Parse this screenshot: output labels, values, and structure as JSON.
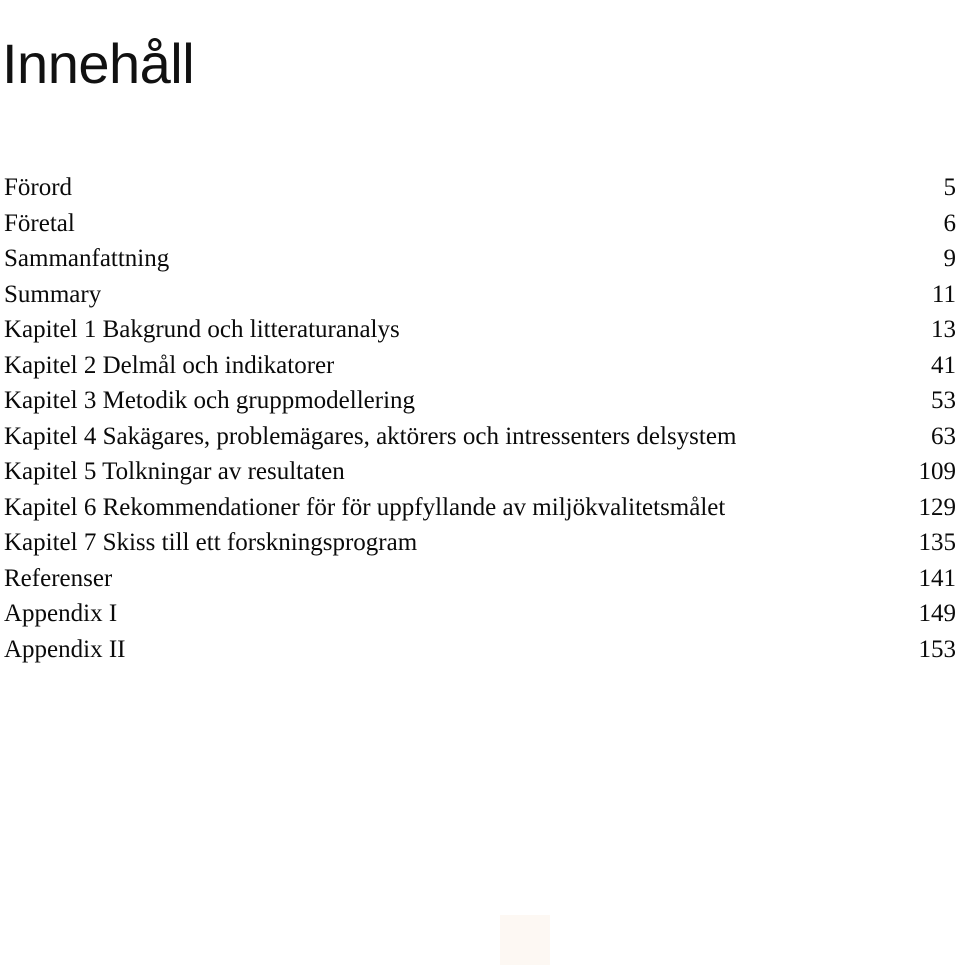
{
  "document": {
    "title": "Innehåll",
    "background_color": "#ffffff",
    "text_color": "#0a0a0a"
  },
  "toc": {
    "entries": [
      {
        "label": "Förord",
        "page": "5"
      },
      {
        "label": "Företal",
        "page": "6"
      },
      {
        "label": "Sammanfattning",
        "page": "9"
      },
      {
        "label": "Summary",
        "page": "11"
      },
      {
        "label": "Kapitel 1 Bakgrund och litteraturanalys",
        "page": "13"
      },
      {
        "label": "Kapitel 2 Delmål och indikatorer",
        "page": "41"
      },
      {
        "label": "Kapitel 3 Metodik och gruppmodellering",
        "page": "53"
      },
      {
        "label": "Kapitel 4 Sakägares, problemägares, aktörers och intressenters delsystem",
        "page": "63"
      },
      {
        "label": "Kapitel 5 Tolkningar av resultaten",
        "page": "109"
      },
      {
        "label": "Kapitel 6 Rekommendationer för för uppfyllande av miljökvalitetsmålet",
        "page": "129"
      },
      {
        "label": "Kapitel 7 Skiss till ett forskningsprogram",
        "page": "135"
      },
      {
        "label": "Referenser",
        "page": "141"
      },
      {
        "label": "Appendix I",
        "page": "149"
      },
      {
        "label": "Appendix II",
        "page": "153"
      }
    ]
  },
  "artifact": {
    "color": "#fdf8f3"
  }
}
